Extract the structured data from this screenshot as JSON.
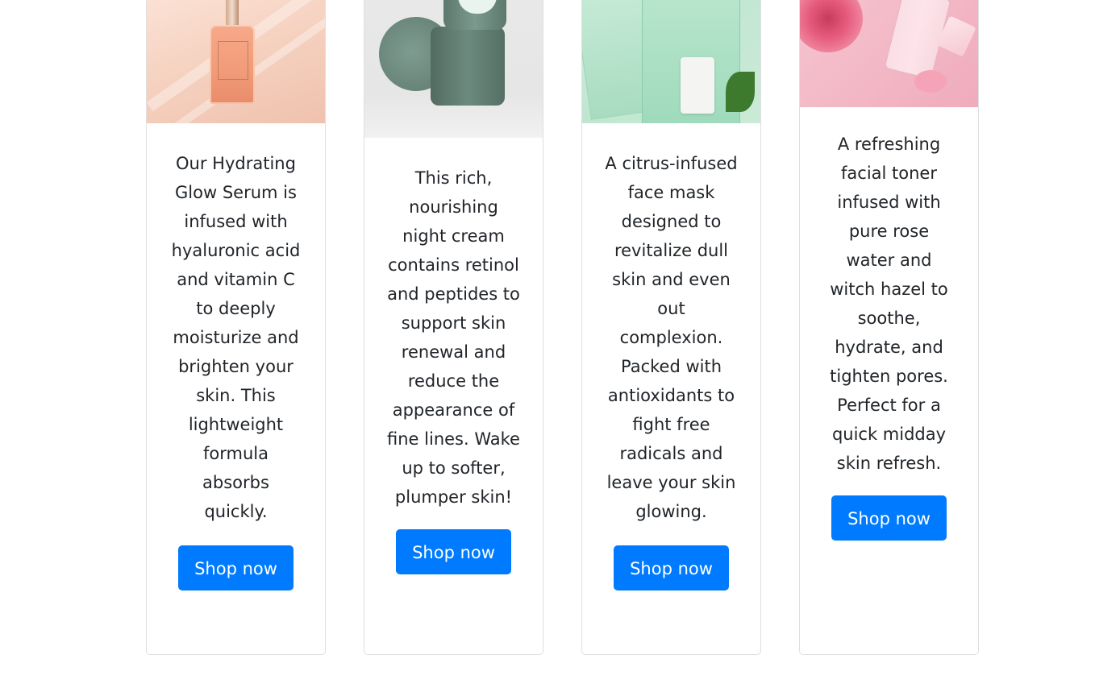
{
  "products": [
    {
      "image_alt": "",
      "description": "Our Hydrating Glow Serum is infused with hyaluronic acid and vitamin C to deeply moisturize and brighten your skin. This lightweight formula absorbs quickly.",
      "button_label": "Shop now"
    },
    {
      "image_alt": "",
      "description": "This rich, nourishing night cream contains retinol and peptides to support skin renewal and reduce the appearance of fine lines. Wake up to softer, plumper skin!",
      "button_label": "Shop now"
    },
    {
      "image_alt": "",
      "description": "A citrus-infused face mask designed to revitalize dull skin and even out complexion. Packed with antioxidants to fight free radicals and leave your skin glowing.",
      "button_label": "Shop now"
    },
    {
      "image_alt": "",
      "description": "A refreshing facial toner infused with pure rose water and witch hazel to soothe, hydrate, and tighten pores. Perfect for a quick midday skin refresh.",
      "button_label": "Shop now"
    }
  ],
  "colors": {
    "button": "#007bff",
    "card_border": "#dfdfdf"
  }
}
